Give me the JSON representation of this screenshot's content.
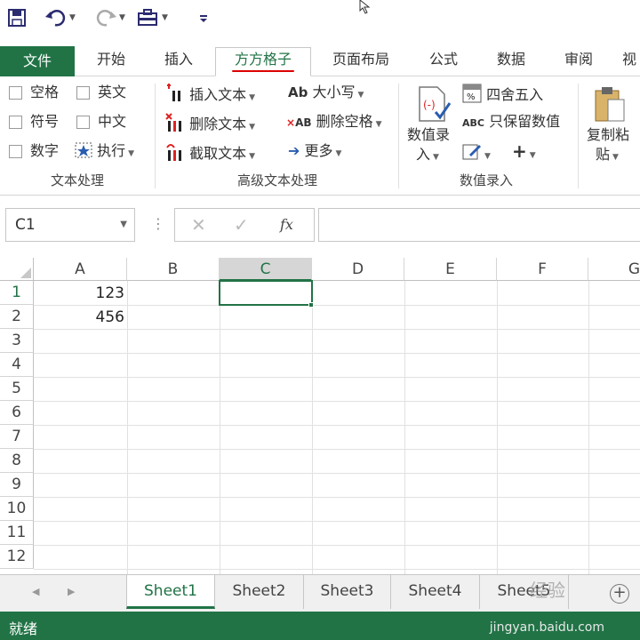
{
  "qat": {
    "save": "save-icon",
    "undo": "undo-icon",
    "redo": "redo-icon",
    "tools": "toolbox-icon",
    "customize": "customize-icon"
  },
  "tabs": [
    "文件",
    "开始",
    "插入",
    "方方格子",
    "页面布局",
    "公式",
    "数据",
    "审阅",
    "视"
  ],
  "ribbon": {
    "text_group": {
      "checks": [
        "空格",
        "英文",
        "符号",
        "中文",
        "数字"
      ],
      "execute": "执行",
      "label": "文本处理"
    },
    "advanced_group": {
      "insert": "插入文本",
      "delete": "删除文本",
      "extract": "截取文本",
      "case": "大小写",
      "delete_space": "删除空格",
      "more": "更多",
      "label": "高级文本处理"
    },
    "numeric_group": {
      "entry_line1": "数值录",
      "entry_line2": "入",
      "round": "四舍五入",
      "keep_values": "只保留数值",
      "plus": "+",
      "label": "数值录入"
    },
    "paste_group": {
      "line1": "复制粘",
      "line2": "贴"
    }
  },
  "formula_bar": {
    "name_box": "C1",
    "fx": "fx"
  },
  "grid": {
    "columns": [
      "A",
      "B",
      "C",
      "D",
      "E",
      "F",
      "G"
    ],
    "rows": [
      "1",
      "2",
      "3",
      "4",
      "5",
      "6",
      "7",
      "8",
      "9",
      "10",
      "11",
      "12"
    ],
    "cells": {
      "A1": "123",
      "A2": "456"
    },
    "selected_cell": "C1"
  },
  "sheets": [
    "Sheet1",
    "Sheet2",
    "Sheet3",
    "Sheet4",
    "Sheet5"
  ],
  "active_sheet": "Sheet1",
  "status": {
    "text": "就绪",
    "watermark": "jingyan.baidu.com",
    "watermark_logo": "经验"
  },
  "colors": {
    "accent": "#217346",
    "underline": "#dd0000"
  }
}
